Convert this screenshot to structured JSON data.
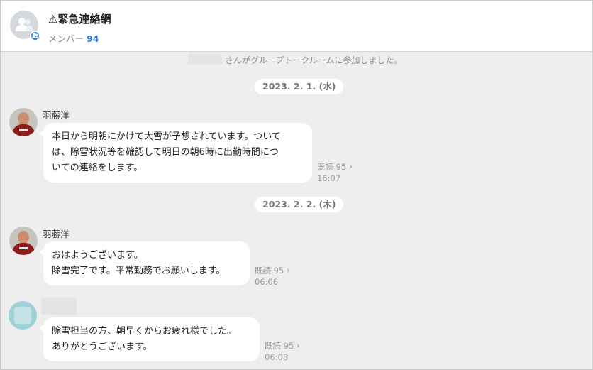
{
  "header": {
    "title": "⚠緊急連絡網",
    "member_label": "メンバー",
    "member_count": "94"
  },
  "notice": {
    "text": "さんがグループトークルームに参加しました。"
  },
  "dates": [
    "2023. 2. 1. (水)",
    "2023. 2. 2. (木)"
  ],
  "messages": [
    {
      "sender": "羽蕂洋",
      "lines": [
        "本日から明朝にかけて大雪が予想されています。ついて",
        "は、除雪状況等を確認して明日の朝6時に出勤時間につ",
        "いての連絡をします。"
      ],
      "read_label": "既読 95",
      "time": "16:07"
    },
    {
      "sender": "羽蕂洋",
      "lines": [
        "おはようございます。",
        "除雪完了です。平常勤務でお願いします。"
      ],
      "read_label": "既読 95",
      "time": "06:06"
    },
    {
      "sender": "",
      "lines": [
        "除雪担当の方、朝早くからお疲れ様でした。",
        "ありがとうございます。"
      ],
      "read_label": "既読 95",
      "time": "06:08"
    }
  ],
  "icons": {
    "group": "group-avatar-icon",
    "member_badge": "member-icon",
    "chevron": "chevron-right-icon"
  },
  "colors": {
    "accent": "#2d7ae0",
    "background": "#eeeeee",
    "bubble": "#ffffff"
  }
}
